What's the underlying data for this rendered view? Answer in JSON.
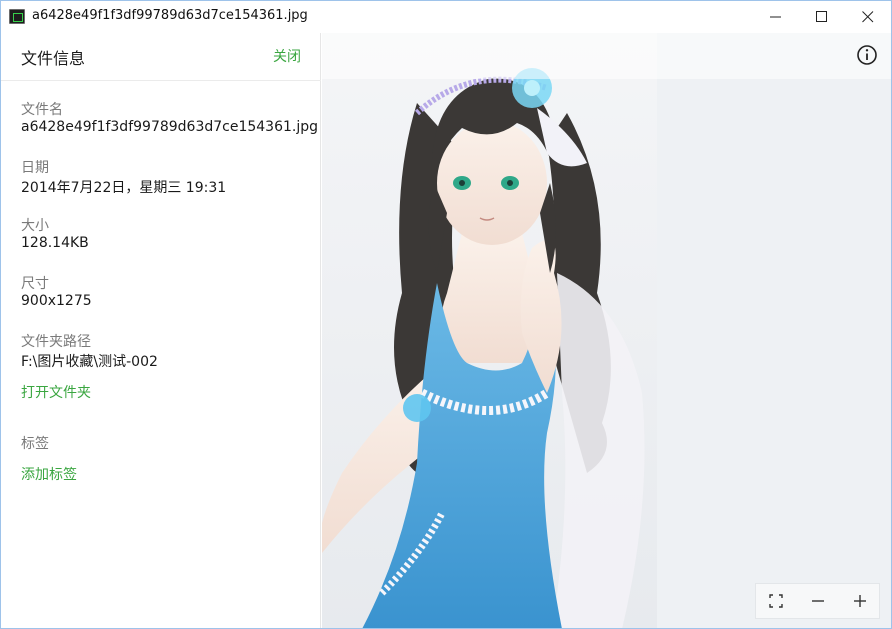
{
  "window": {
    "title": "a6428e49f1f3df99789d63d7ce154361.jpg"
  },
  "panel": {
    "title": "文件信息",
    "close_label": "关闭",
    "fields": {
      "filename": {
        "label": "文件名",
        "value": "a6428e49f1f3df99789d63d7ce154361.jpg"
      },
      "date": {
        "label": "日期",
        "value": "2014年7月22日，星期三  19:31"
      },
      "size": {
        "label": "大小",
        "value": "128.14KB"
      },
      "dimensions": {
        "label": "尺寸",
        "value": "900x1275"
      },
      "folder": {
        "label": "文件夹路径",
        "value": "F:\\图片收藏\\测试-002"
      }
    },
    "open_folder_label": "打开文件夹",
    "tags_label": "标签",
    "add_tag_label": "添加标签"
  },
  "icons": {
    "app": "app-icon",
    "minimize": "minimize-icon",
    "maximize": "maximize-icon",
    "close": "close-icon",
    "info": "info-icon",
    "fullscreen": "fullscreen-icon",
    "zoom_out": "minus-icon",
    "zoom_in": "plus-icon"
  },
  "colors": {
    "accent_green": "#3aa640",
    "window_border": "#9ec3ea",
    "dress_blue": "#4fa8de",
    "hair": "#3b3836"
  }
}
